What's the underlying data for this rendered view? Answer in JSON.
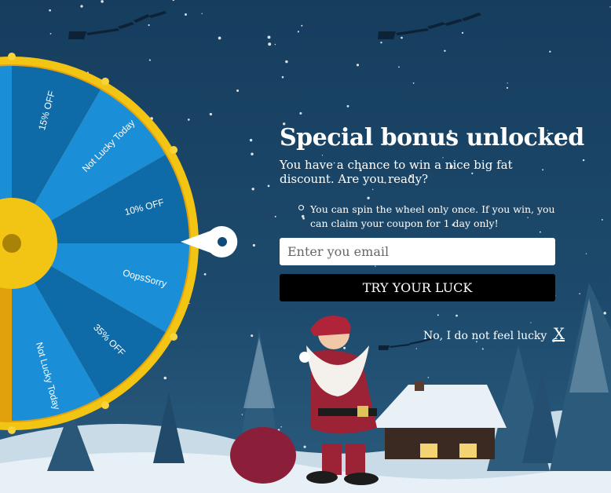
{
  "popup": {
    "title": "Special bonus unlocked",
    "subtitle": "You have a chance to win a nice big fat discount. Are you ready?",
    "rule": "You can spin the wheel only once. If you win, you can claim your coupon for 1 day only!",
    "email_placeholder": "Enter you email",
    "cta_label": "TRY YOUR LUCK",
    "dismiss_label": "No, I do not feel lucky",
    "dismiss_x": "X"
  },
  "wheel": {
    "segments": [
      "OopsSorry",
      "15% OFF",
      "Not Lucky Today",
      "10% OFF",
      "OopsSorry",
      "35% OFF",
      "Not Lucky Today"
    ]
  },
  "colors": {
    "sky": "#1c4768",
    "wheel_rim": "#f2c414",
    "segment_light": "#1a8fd8",
    "segment_dark": "#0f6aa8",
    "button": "#000000"
  }
}
